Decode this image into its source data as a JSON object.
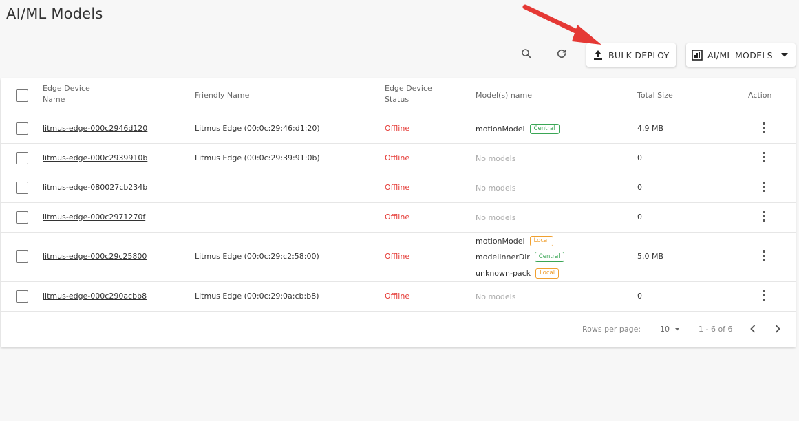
{
  "page": {
    "title": "AI/ML Models"
  },
  "toolbar": {
    "bulk_deploy_label": "BULK DEPLOY",
    "view_select_label": "AI/ML MODELS"
  },
  "table": {
    "headers": {
      "edge_device_name_1": "Edge Device",
      "edge_device_name_2": "Name",
      "friendly_name": "Friendly Name",
      "status_1": "Edge Device",
      "status_2": "Status",
      "models": "Model(s) name",
      "total_size": "Total Size",
      "action": "Action"
    },
    "rows": [
      {
        "device": "litmus-edge-000c2946d120",
        "friendly": "Litmus Edge (00:0c:29:46:d1:20)",
        "status": "Offline",
        "models": [
          {
            "name": "motionModel",
            "badge": "Central"
          }
        ],
        "no_models": "",
        "size": "4.9 MB"
      },
      {
        "device": "litmus-edge-000c2939910b",
        "friendly": "Litmus Edge (00:0c:29:39:91:0b)",
        "status": "Offline",
        "models": [],
        "no_models": "No models",
        "size": "0"
      },
      {
        "device": "litmus-edge-080027cb234b",
        "friendly": "",
        "status": "Offline",
        "models": [],
        "no_models": "No models",
        "size": "0"
      },
      {
        "device": "litmus-edge-000c2971270f",
        "friendly": "",
        "status": "Offline",
        "models": [],
        "no_models": "No models",
        "size": "0"
      },
      {
        "device": "litmus-edge-000c29c25800",
        "friendly": "Litmus Edge (00:0c:29:c2:58:00)",
        "status": "Offline",
        "models": [
          {
            "name": "motionModel",
            "badge": "Local"
          },
          {
            "name": "modelInnerDir",
            "badge": "Central"
          },
          {
            "name": "unknown-pack",
            "badge": "Local"
          }
        ],
        "no_models": "",
        "size": "5.0 MB"
      },
      {
        "device": "litmus-edge-000c290acbb8",
        "friendly": "Litmus Edge (00:0c:29:0a:cb:b8)",
        "status": "Offline",
        "models": [],
        "no_models": "No models",
        "size": "0"
      }
    ]
  },
  "pagination": {
    "rows_per_page_label": "Rows per page:",
    "rows_per_page_value": "10",
    "range_text": "1 - 6 of 6"
  },
  "colors": {
    "offline": "#e53935",
    "central_badge": "#3aa655",
    "local_badge": "#f0a030",
    "annotation_arrow": "#e53935"
  }
}
